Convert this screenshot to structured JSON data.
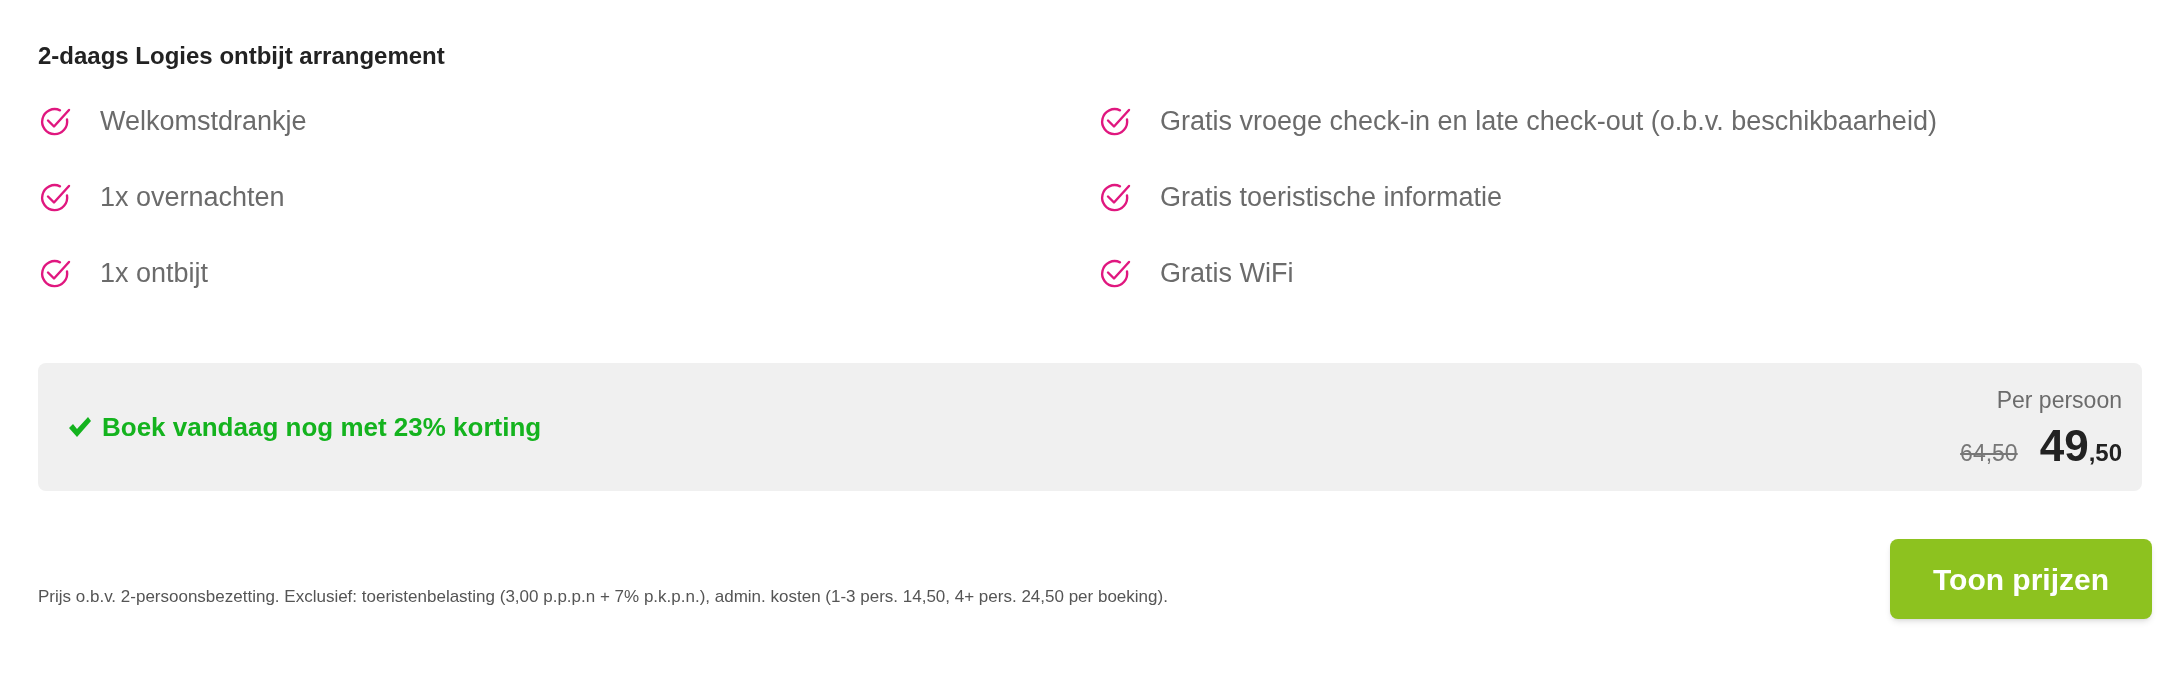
{
  "title": "2-daags Logies ontbijt arrangement",
  "features": [
    {
      "label": "Welkomstdrankje"
    },
    {
      "label": "Gratis vroege check-in en late check-out (o.b.v. beschikbaarheid)"
    },
    {
      "label": "1x overnachten"
    },
    {
      "label": "Gratis toeristische informatie"
    },
    {
      "label": "1x ontbijt"
    },
    {
      "label": "Gratis WiFi"
    }
  ],
  "offer": {
    "discount_text": "Boek vandaag nog met 23% korting",
    "price_caption": "Per persoon",
    "old_price": "64,50",
    "price_whole": "49",
    "price_cents": ",50"
  },
  "footnote": "Prijs o.b.v. 2-persoonsbezetting. Exclusief: toeristenbelasting (3,00 p.p.p.n + 7% p.k.p.n.), admin. kosten (1-3 pers. 14,50, 4+ pers. 24,50 per boeking).",
  "button": "Toon prijzen"
}
